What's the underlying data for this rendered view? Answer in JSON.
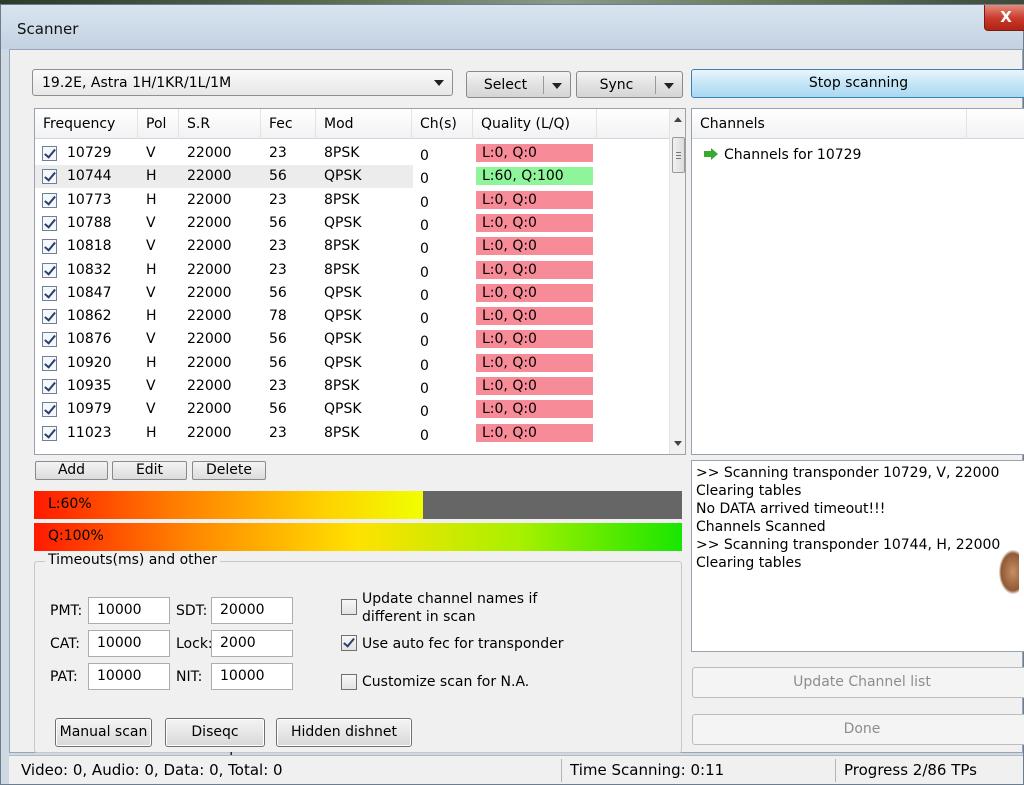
{
  "window": {
    "title": "Scanner",
    "close": "X"
  },
  "toolbar": {
    "satellite": "19.2E,  Astra 1H/1KR/1L/1M",
    "select_label": "Select",
    "sync_label": "Sync",
    "stop_label": "Stop scanning"
  },
  "transponders": {
    "columns": [
      "Frequency",
      "Pol",
      "S.R",
      "Fec",
      "Mod",
      "Ch(s)",
      "Quality (L/Q)"
    ],
    "rows": [
      {
        "checked": true,
        "freq": "10729",
        "pol": "V",
        "sr": "22000",
        "fec": "23",
        "mod": "8PSK",
        "ch": "0",
        "quality": "L:0, Q:0",
        "status": "bad"
      },
      {
        "checked": true,
        "freq": "10744",
        "pol": "H",
        "sr": "22000",
        "fec": "56",
        "mod": "QPSK",
        "ch": "0",
        "quality": "L:60, Q:100",
        "status": "good"
      },
      {
        "checked": true,
        "freq": "10773",
        "pol": "H",
        "sr": "22000",
        "fec": "23",
        "mod": "8PSK",
        "ch": "0",
        "quality": "L:0, Q:0",
        "status": "bad"
      },
      {
        "checked": true,
        "freq": "10788",
        "pol": "V",
        "sr": "22000",
        "fec": "56",
        "mod": "QPSK",
        "ch": "0",
        "quality": "L:0, Q:0",
        "status": "bad"
      },
      {
        "checked": true,
        "freq": "10818",
        "pol": "V",
        "sr": "22000",
        "fec": "23",
        "mod": "8PSK",
        "ch": "0",
        "quality": "L:0, Q:0",
        "status": "bad"
      },
      {
        "checked": true,
        "freq": "10832",
        "pol": "H",
        "sr": "22000",
        "fec": "23",
        "mod": "8PSK",
        "ch": "0",
        "quality": "L:0, Q:0",
        "status": "bad"
      },
      {
        "checked": true,
        "freq": "10847",
        "pol": "V",
        "sr": "22000",
        "fec": "56",
        "mod": "QPSK",
        "ch": "0",
        "quality": "L:0, Q:0",
        "status": "bad"
      },
      {
        "checked": true,
        "freq": "10862",
        "pol": "H",
        "sr": "22000",
        "fec": "78",
        "mod": "QPSK",
        "ch": "0",
        "quality": "L:0, Q:0",
        "status": "bad"
      },
      {
        "checked": true,
        "freq": "10876",
        "pol": "V",
        "sr": "22000",
        "fec": "56",
        "mod": "QPSK",
        "ch": "0",
        "quality": "L:0, Q:0",
        "status": "bad"
      },
      {
        "checked": true,
        "freq": "10920",
        "pol": "H",
        "sr": "22000",
        "fec": "56",
        "mod": "QPSK",
        "ch": "0",
        "quality": "L:0, Q:0",
        "status": "bad"
      },
      {
        "checked": true,
        "freq": "10935",
        "pol": "V",
        "sr": "22000",
        "fec": "23",
        "mod": "8PSK",
        "ch": "0",
        "quality": "L:0, Q:0",
        "status": "bad"
      },
      {
        "checked": true,
        "freq": "10979",
        "pol": "V",
        "sr": "22000",
        "fec": "56",
        "mod": "QPSK",
        "ch": "0",
        "quality": "L:0, Q:0",
        "status": "bad"
      },
      {
        "checked": true,
        "freq": "11023",
        "pol": "H",
        "sr": "22000",
        "fec": "23",
        "mod": "8PSK",
        "ch": "0",
        "quality": "L:0, Q:0",
        "status": "bad"
      }
    ]
  },
  "channels": {
    "header": "Channels",
    "item": "Channels for 10729"
  },
  "list_buttons": {
    "add": "Add",
    "edit": "Edit",
    "delete": "Delete"
  },
  "meters": {
    "level": {
      "label": "L:60%",
      "value": 0.6
    },
    "quality": {
      "label": "Q:100%",
      "value": 1.0
    }
  },
  "timeouts": {
    "title": "Timeouts(ms) and other",
    "pmt_label": "PMT:",
    "pmt": "10000",
    "cat_label": "CAT:",
    "cat": "10000",
    "pat_label": "PAT:",
    "pat": "10000",
    "sdt_label": "SDT:",
    "sdt": "20000",
    "lock_label": "Lock:",
    "lock": "2000",
    "nit_label": "NIT:",
    "nit": "10000",
    "opt_update_line1": "Update channel names if",
    "opt_update_line2": "different in scan",
    "opt_update_checked": false,
    "opt_autofec": "Use auto fec for transponder",
    "opt_autofec_checked": true,
    "opt_na": "Customize scan for N.A.",
    "opt_na_checked": false
  },
  "actions": {
    "manual": "Manual scan",
    "diseqc": "Diseqc console",
    "hidden": "Hidden dishnet"
  },
  "log": [
    ">> Scanning transponder 10729, V, 22000",
    "Clearing tables",
    "No DATA arrived timeout!!!",
    "Channels Scanned",
    ">> Scanning transponder 10744, H, 22000",
    "Clearing tables"
  ],
  "right_buttons": {
    "update": "Update Channel list",
    "done": "Done"
  },
  "status": {
    "counts": "Video: 0, Audio: 0, Data: 0, Total: 0",
    "time": "Time Scanning: 0:11",
    "progress": "Progress 2/86 TPs"
  },
  "colors": {
    "quality_bad": "#f88b98",
    "quality_good": "#8ff59a",
    "accent_button": "#a9d9f2"
  }
}
